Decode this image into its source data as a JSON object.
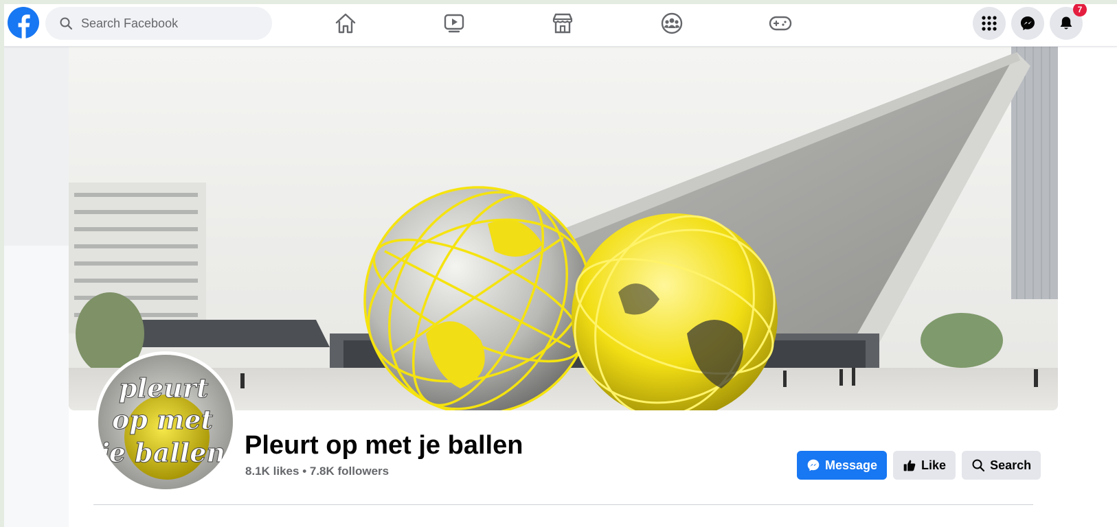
{
  "topnav": {
    "search_placeholder": "Search Facebook",
    "nav_icons": [
      "home-icon",
      "watch-icon",
      "marketplace-icon",
      "groups-icon",
      "gaming-icon"
    ],
    "right_icons": [
      "menu-grid-icon",
      "messenger-icon",
      "notifications-bell-icon"
    ],
    "notifications_badge": "7"
  },
  "page": {
    "avatar_text": [
      "pleurt",
      "op met",
      "je ballen"
    ],
    "title": "Pleurt op met je ballen",
    "likes": "8.1K likes",
    "separator": "•",
    "followers": "7.8K followers"
  },
  "actions": {
    "message_label": "Message",
    "like_label": "Like",
    "search_label": "Search"
  },
  "colors": {
    "brand_blue": "#1877f2",
    "secondary_btn": "#e4e6eb",
    "badge_red": "#e41e3f",
    "globe_yellow": "#f5e30f"
  }
}
